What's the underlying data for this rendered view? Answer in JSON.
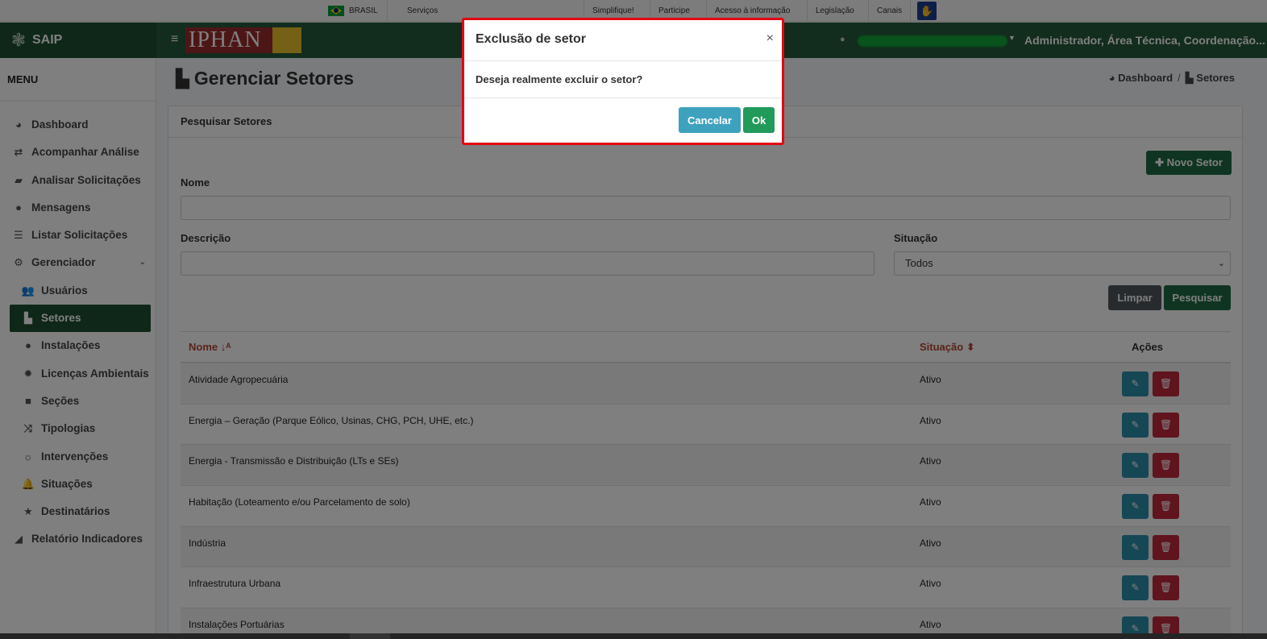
{
  "govbar": {
    "country": "BRASIL",
    "services": "Serviços",
    "links": [
      "Simplifique!",
      "Participe",
      "Acesso à informação",
      "Legislação",
      "Canais"
    ]
  },
  "header": {
    "app_name": "SAIP",
    "logo_text": "IPHAN",
    "user_roles": "Administrador, Área Técnica, Coordenação..."
  },
  "sidebar": {
    "menu_title": "MENU",
    "items": [
      {
        "label": "Dashboard",
        "icon": "dashboard-icon"
      },
      {
        "label": "Acompanhar Análise",
        "icon": "exchange-icon"
      },
      {
        "label": "Analisar Solicitações",
        "icon": "book-icon"
      },
      {
        "label": "Mensagens",
        "icon": "comments-icon"
      },
      {
        "label": "Listar Solicitações",
        "icon": "list-icon"
      },
      {
        "label": "Gerenciador",
        "icon": "cogs-icon"
      },
      {
        "label": "Usuários",
        "icon": "users-icon"
      },
      {
        "label": "Setores",
        "icon": "industry-icon"
      },
      {
        "label": "Instalações",
        "icon": "circle-icon"
      },
      {
        "label": "Licenças Ambientais",
        "icon": "certificate-icon"
      },
      {
        "label": "Seções",
        "icon": "square-icon"
      },
      {
        "label": "Tipologias",
        "icon": "random-icon"
      },
      {
        "label": "Intervenções",
        "icon": "sun-icon"
      },
      {
        "label": "Situações",
        "icon": "bell-icon"
      },
      {
        "label": "Destinatários",
        "icon": "star-icon"
      },
      {
        "label": "Relatório Indicadores",
        "icon": "area-chart-icon"
      }
    ]
  },
  "page": {
    "title": "Gerenciar Setores",
    "breadcrumb": {
      "home": "Dashboard",
      "current": "Setores"
    }
  },
  "search": {
    "card_title": "Pesquisar Setores",
    "new_button": "Novo Setor",
    "nome_label": "Nome",
    "descricao_label": "Descrição",
    "situacao_label": "Situação",
    "situacao_value": "Todos",
    "clear_button": "Limpar",
    "search_button": "Pesquisar"
  },
  "table": {
    "headers": {
      "nome": "Nome",
      "situacao": "Situação",
      "acoes": "Ações"
    },
    "rows": [
      {
        "nome": "Atividade Agropecuária",
        "situacao": "Ativo"
      },
      {
        "nome": "Energia – Geração (Parque Eólico, Usinas, CHG, PCH, UHE, etc.)",
        "situacao": "Ativo"
      },
      {
        "nome": "Energia - Transmissão e Distribuição (LTs e SEs)",
        "situacao": "Ativo"
      },
      {
        "nome": "Habitação (Loteamento e/ou Parcelamento de solo)",
        "situacao": "Ativo"
      },
      {
        "nome": "Indústria",
        "situacao": "Ativo"
      },
      {
        "nome": "Infraestrutura Urbana",
        "situacao": "Ativo"
      },
      {
        "nome": "Instalações Portuárias",
        "situacao": "Ativo"
      }
    ]
  },
  "modal": {
    "title": "Exclusão de setor",
    "close": "×",
    "message": "Deseja realmente excluir o setor?",
    "cancel_button": "Cancelar",
    "ok_button": "Ok"
  },
  "colors": {
    "brand_green": "#1e4f33",
    "header_green": "#24593a",
    "danger": "#c0283a",
    "info": "#2d8eab",
    "highlight_border": "#e30613"
  }
}
